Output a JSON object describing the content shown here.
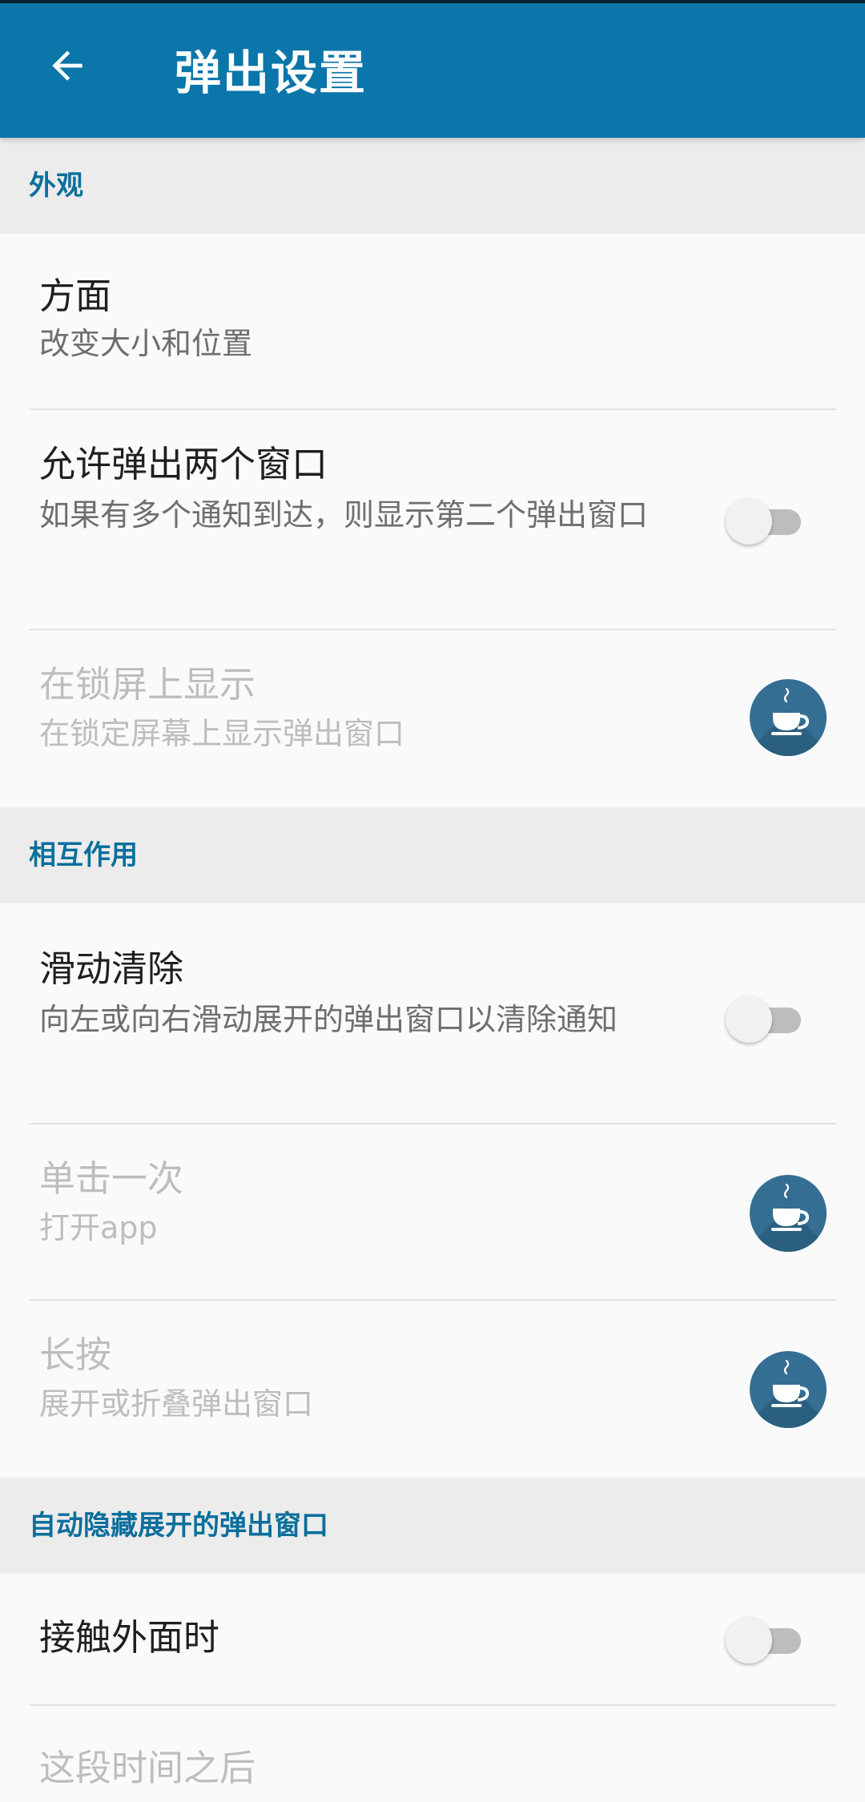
{
  "appbar": {
    "title": "弹出设置"
  },
  "icons": {
    "back": "arrow-back-icon",
    "pro": "coffee-cup-icon"
  },
  "colors": {
    "appbar": "#0b76aa",
    "section_text": "#0b6f9c",
    "pro_badge": "#346f93"
  },
  "sections": [
    {
      "header": "外观",
      "items": [
        {
          "title": "方面",
          "summary": "改变大小和位置",
          "control": "none",
          "enabled": true
        },
        {
          "title": "允许弹出两个窗口",
          "summary": "如果有多个通知到达，则显示第二个弹出窗口",
          "control": "switch",
          "checked": false,
          "enabled": true
        },
        {
          "title": "在锁屏上显示",
          "summary": "在锁定屏幕上显示弹出窗口",
          "control": "pro",
          "enabled": false
        }
      ]
    },
    {
      "header": "相互作用",
      "items": [
        {
          "title": "滑动清除",
          "summary": "向左或向右滑动展开的弹出窗口以清除通知",
          "control": "switch",
          "checked": false,
          "enabled": true
        },
        {
          "title": "单击一次",
          "summary": "打开app",
          "control": "pro",
          "enabled": false
        },
        {
          "title": "长按",
          "summary": "展开或折叠弹出窗口",
          "control": "pro",
          "enabled": false
        }
      ]
    },
    {
      "header": "自动隐藏展开的弹出窗口",
      "items": [
        {
          "title": "接触外面时",
          "summary": "",
          "control": "switch",
          "checked": false,
          "enabled": true
        },
        {
          "title": "这段时间之后",
          "summary": "",
          "control": "none",
          "enabled": false
        }
      ]
    }
  ]
}
